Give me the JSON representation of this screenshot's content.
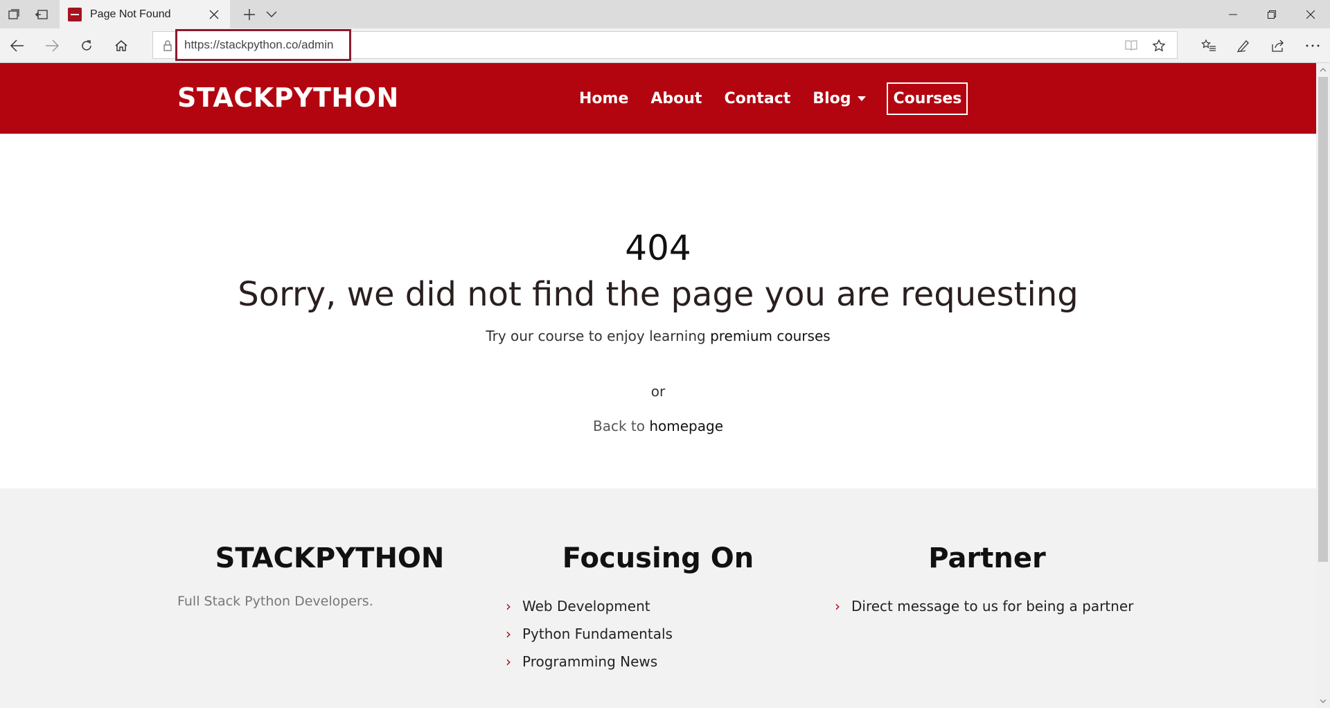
{
  "browser": {
    "tab": {
      "title": "Page Not Found"
    },
    "address": {
      "url": "https://stackpython.co/admin"
    },
    "icons": {
      "tab_actions": "tabs-aside-icon",
      "set_aside": "set-aside-icon",
      "new_tab": "plus-icon",
      "tab_list": "chevron-down-icon",
      "back": "back-arrow-icon",
      "forward": "forward-arrow-icon",
      "refresh": "refresh-icon",
      "home": "home-icon",
      "lock": "lock-icon",
      "reading_view": "reading-view-icon",
      "favorite": "star-icon",
      "favorites_hub": "favorites-list-icon",
      "pen": "pen-icon",
      "share": "share-icon",
      "more": "more-icon"
    },
    "accent": "#8b1a2b"
  },
  "site": {
    "brand": "STACKPYTHON",
    "nav": [
      {
        "label": "Home"
      },
      {
        "label": "About"
      },
      {
        "label": "Contact"
      },
      {
        "label": "Blog"
      },
      {
        "label": "Courses"
      }
    ],
    "colors": {
      "primary": "#b30510"
    }
  },
  "error": {
    "code": "404",
    "headline": "Sorry, we did not find the page you are requesting",
    "try_prefix": "Try our course to enjoy learning ",
    "try_link": "premium courses",
    "or": "or",
    "back_prefix": "Back to ",
    "back_link": "homepage"
  },
  "footer": {
    "col1": {
      "title": "STACKPYTHON",
      "tagline": "Full Stack Python Developers."
    },
    "col2": {
      "title": "Focusing On",
      "items": [
        "Web Development",
        "Python Fundamentals",
        "Programming News"
      ]
    },
    "col3": {
      "title": "Partner",
      "items": [
        "Direct message to us for being a partner"
      ]
    }
  }
}
